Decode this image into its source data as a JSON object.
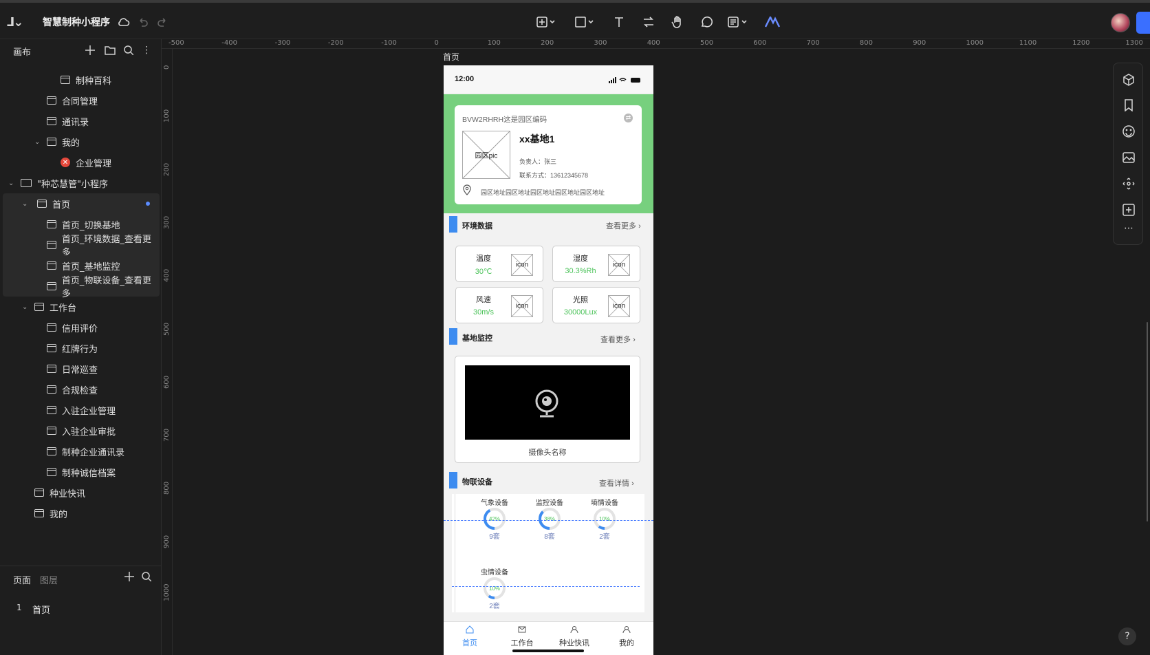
{
  "toolbar": {
    "doc_name": "智慧制种小程序"
  },
  "sidebar": {
    "canvas_label": "画布",
    "items": [
      {
        "label": "制种百科"
      },
      {
        "label": "合同管理"
      },
      {
        "label": "通讯录"
      },
      {
        "label": "我的"
      },
      {
        "label": "企业管理"
      },
      {
        "label": "\"种芯慧管\"小程序"
      },
      {
        "label": "首页"
      },
      {
        "label": "首页_切换基地"
      },
      {
        "label": "首页_环境数据_查看更多"
      },
      {
        "label": "首页_基地监控"
      },
      {
        "label": "首页_物联设备_查看更多"
      },
      {
        "label": "工作台"
      },
      {
        "label": "信用评价"
      },
      {
        "label": "红牌行为"
      },
      {
        "label": "日常巡查"
      },
      {
        "label": "合规检查"
      },
      {
        "label": "入驻企业管理"
      },
      {
        "label": "入驻企业审批"
      },
      {
        "label": "制种企业通讯录"
      },
      {
        "label": "制种诚信档案"
      },
      {
        "label": "种业快讯"
      },
      {
        "label": "我的"
      }
    ],
    "pages_tab": "页面",
    "layers_tab": "图层",
    "page_number": "1",
    "page_name": "首页"
  },
  "ruler": {
    "h": [
      "-500",
      "-400",
      "-300",
      "-200",
      "-100",
      "0",
      "100",
      "200",
      "300",
      "400",
      "500",
      "600",
      "700",
      "800",
      "900",
      "1000",
      "1100",
      "1200",
      "1300"
    ],
    "v": [
      "0",
      "100",
      "200",
      "300",
      "400",
      "500",
      "600",
      "700",
      "800",
      "900",
      "1000"
    ]
  },
  "frame": {
    "label": "首页",
    "time": "12:00",
    "base": {
      "code": "BVW2RHRH这是园区编码",
      "pic": "园区pic",
      "name": "xx基地1",
      "manager": "负责人：张三",
      "contact": "联系方式：13612345678",
      "address": "园区地址园区地址园区地址园区地址园区地址"
    },
    "env": {
      "title": "环境数据",
      "more": "查看更多",
      "items": [
        {
          "name": "温度",
          "value": "30℃",
          "icon": "icon"
        },
        {
          "name": "湿度",
          "value": "30.3%Rh",
          "icon": "icon"
        },
        {
          "name": "风速",
          "value": "30m/s",
          "icon": "icon"
        },
        {
          "name": "光照",
          "value": "30000Lux",
          "icon": "icon"
        }
      ]
    },
    "monitor": {
      "title": "基地监控",
      "more": "查看更多",
      "camera_name": "摄像头名称"
    },
    "iot": {
      "title": "物联设备",
      "more": "查看详情",
      "devices": [
        {
          "name": "气象设备",
          "percent": "42%",
          "count": "9套",
          "fraction": 0.42
        },
        {
          "name": "监控设备",
          "percent": "38%",
          "count": "8套",
          "fraction": 0.38
        },
        {
          "name": "墒情设备",
          "percent": "10%",
          "count": "2套",
          "fraction": 0.1
        },
        {
          "name": "虫情设备",
          "percent": "10%",
          "count": "2套",
          "fraction": 0.1
        }
      ]
    },
    "tabs": [
      {
        "label": "首页"
      },
      {
        "label": "工作台"
      },
      {
        "label": "种业快讯"
      },
      {
        "label": "我的"
      }
    ],
    "colors": {
      "accent": "#3d8cf0",
      "green": "#77d07e",
      "value_green": "#4cc35a"
    }
  }
}
